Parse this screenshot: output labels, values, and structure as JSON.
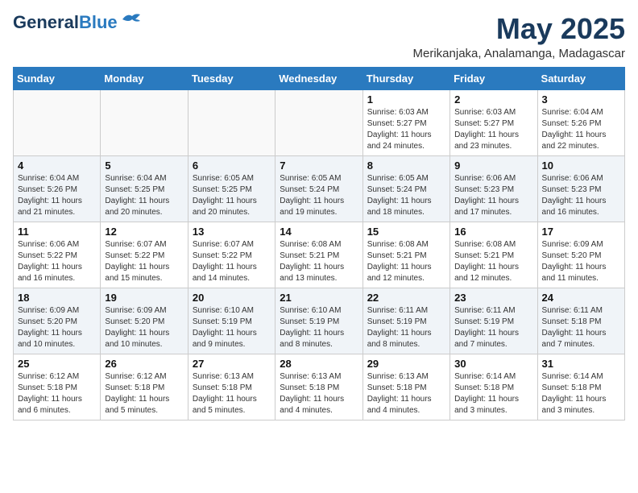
{
  "header": {
    "logo_line1": "General",
    "logo_line2": "Blue",
    "month_title": "May 2025",
    "location": "Merikanjaka, Analamanga, Madagascar"
  },
  "weekdays": [
    "Sunday",
    "Monday",
    "Tuesday",
    "Wednesday",
    "Thursday",
    "Friday",
    "Saturday"
  ],
  "weeks": [
    [
      {
        "day": "",
        "info": ""
      },
      {
        "day": "",
        "info": ""
      },
      {
        "day": "",
        "info": ""
      },
      {
        "day": "",
        "info": ""
      },
      {
        "day": "1",
        "info": "Sunrise: 6:03 AM\nSunset: 5:27 PM\nDaylight: 11 hours\nand 24 minutes."
      },
      {
        "day": "2",
        "info": "Sunrise: 6:03 AM\nSunset: 5:27 PM\nDaylight: 11 hours\nand 23 minutes."
      },
      {
        "day": "3",
        "info": "Sunrise: 6:04 AM\nSunset: 5:26 PM\nDaylight: 11 hours\nand 22 minutes."
      }
    ],
    [
      {
        "day": "4",
        "info": "Sunrise: 6:04 AM\nSunset: 5:26 PM\nDaylight: 11 hours\nand 21 minutes."
      },
      {
        "day": "5",
        "info": "Sunrise: 6:04 AM\nSunset: 5:25 PM\nDaylight: 11 hours\nand 20 minutes."
      },
      {
        "day": "6",
        "info": "Sunrise: 6:05 AM\nSunset: 5:25 PM\nDaylight: 11 hours\nand 20 minutes."
      },
      {
        "day": "7",
        "info": "Sunrise: 6:05 AM\nSunset: 5:24 PM\nDaylight: 11 hours\nand 19 minutes."
      },
      {
        "day": "8",
        "info": "Sunrise: 6:05 AM\nSunset: 5:24 PM\nDaylight: 11 hours\nand 18 minutes."
      },
      {
        "day": "9",
        "info": "Sunrise: 6:06 AM\nSunset: 5:23 PM\nDaylight: 11 hours\nand 17 minutes."
      },
      {
        "day": "10",
        "info": "Sunrise: 6:06 AM\nSunset: 5:23 PM\nDaylight: 11 hours\nand 16 minutes."
      }
    ],
    [
      {
        "day": "11",
        "info": "Sunrise: 6:06 AM\nSunset: 5:22 PM\nDaylight: 11 hours\nand 16 minutes."
      },
      {
        "day": "12",
        "info": "Sunrise: 6:07 AM\nSunset: 5:22 PM\nDaylight: 11 hours\nand 15 minutes."
      },
      {
        "day": "13",
        "info": "Sunrise: 6:07 AM\nSunset: 5:22 PM\nDaylight: 11 hours\nand 14 minutes."
      },
      {
        "day": "14",
        "info": "Sunrise: 6:08 AM\nSunset: 5:21 PM\nDaylight: 11 hours\nand 13 minutes."
      },
      {
        "day": "15",
        "info": "Sunrise: 6:08 AM\nSunset: 5:21 PM\nDaylight: 11 hours\nand 12 minutes."
      },
      {
        "day": "16",
        "info": "Sunrise: 6:08 AM\nSunset: 5:21 PM\nDaylight: 11 hours\nand 12 minutes."
      },
      {
        "day": "17",
        "info": "Sunrise: 6:09 AM\nSunset: 5:20 PM\nDaylight: 11 hours\nand 11 minutes."
      }
    ],
    [
      {
        "day": "18",
        "info": "Sunrise: 6:09 AM\nSunset: 5:20 PM\nDaylight: 11 hours\nand 10 minutes."
      },
      {
        "day": "19",
        "info": "Sunrise: 6:09 AM\nSunset: 5:20 PM\nDaylight: 11 hours\nand 10 minutes."
      },
      {
        "day": "20",
        "info": "Sunrise: 6:10 AM\nSunset: 5:19 PM\nDaylight: 11 hours\nand 9 minutes."
      },
      {
        "day": "21",
        "info": "Sunrise: 6:10 AM\nSunset: 5:19 PM\nDaylight: 11 hours\nand 8 minutes."
      },
      {
        "day": "22",
        "info": "Sunrise: 6:11 AM\nSunset: 5:19 PM\nDaylight: 11 hours\nand 8 minutes."
      },
      {
        "day": "23",
        "info": "Sunrise: 6:11 AM\nSunset: 5:19 PM\nDaylight: 11 hours\nand 7 minutes."
      },
      {
        "day": "24",
        "info": "Sunrise: 6:11 AM\nSunset: 5:18 PM\nDaylight: 11 hours\nand 7 minutes."
      }
    ],
    [
      {
        "day": "25",
        "info": "Sunrise: 6:12 AM\nSunset: 5:18 PM\nDaylight: 11 hours\nand 6 minutes."
      },
      {
        "day": "26",
        "info": "Sunrise: 6:12 AM\nSunset: 5:18 PM\nDaylight: 11 hours\nand 5 minutes."
      },
      {
        "day": "27",
        "info": "Sunrise: 6:13 AM\nSunset: 5:18 PM\nDaylight: 11 hours\nand 5 minutes."
      },
      {
        "day": "28",
        "info": "Sunrise: 6:13 AM\nSunset: 5:18 PM\nDaylight: 11 hours\nand 4 minutes."
      },
      {
        "day": "29",
        "info": "Sunrise: 6:13 AM\nSunset: 5:18 PM\nDaylight: 11 hours\nand 4 minutes."
      },
      {
        "day": "30",
        "info": "Sunrise: 6:14 AM\nSunset: 5:18 PM\nDaylight: 11 hours\nand 3 minutes."
      },
      {
        "day": "31",
        "info": "Sunrise: 6:14 AM\nSunset: 5:18 PM\nDaylight: 11 hours\nand 3 minutes."
      }
    ]
  ]
}
